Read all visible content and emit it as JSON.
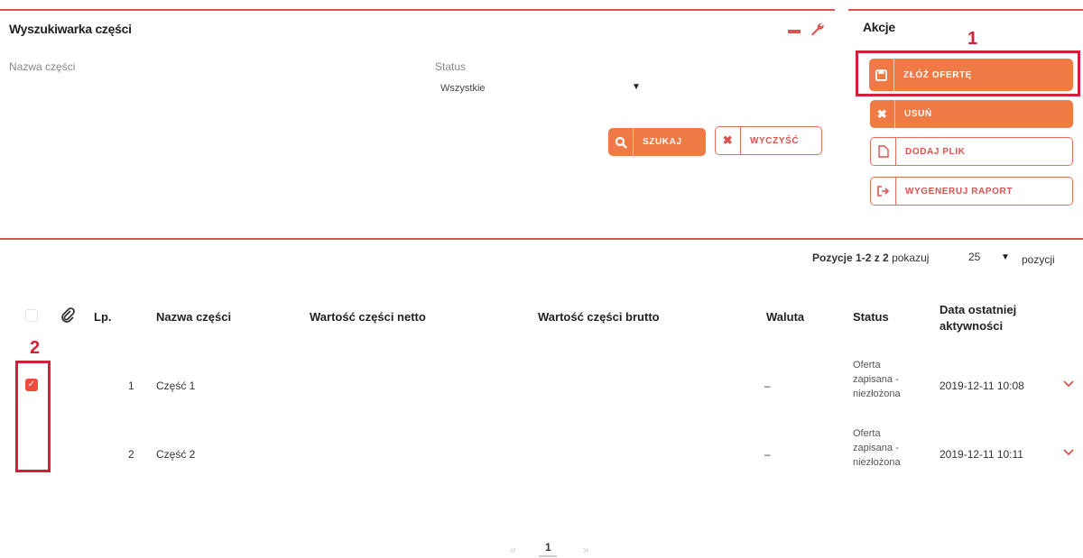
{
  "search_panel": {
    "title": "Wyszukiwarka części",
    "name_label": "Nazwa części",
    "status_label": "Status",
    "status_value": "Wszystkie",
    "search_button": "SZUKAJ",
    "clear_button": "WYCZYŚĆ"
  },
  "actions_panel": {
    "title": "Akcje",
    "buttons": [
      {
        "label": "ZŁÓŻ OFERTĘ",
        "icon": "save-icon"
      },
      {
        "label": "USUŃ",
        "icon": "close-icon"
      },
      {
        "label": "DODAJ PLIK",
        "icon": "file-icon"
      },
      {
        "label": "WYGENERUJ RAPORT",
        "icon": "export-icon"
      }
    ]
  },
  "annotations": {
    "one": "1",
    "two": "2"
  },
  "pagination_info": {
    "range": "Pozycje 1-2 z 2",
    "show": "pokazuj",
    "per_page": "25",
    "items": "pozycji"
  },
  "table": {
    "headers": {
      "lp": "Lp.",
      "name": "Nazwa części",
      "net": "Wartość części netto",
      "gross": "Wartość części brutto",
      "currency": "Waluta",
      "status": "Status",
      "last_activity": "Data ostatniej aktywności"
    },
    "rows": [
      {
        "lp": "1",
        "name": "Część 1",
        "currency": "–",
        "status_l1": "Oferta",
        "status_l2": "zapisana -",
        "status_l3": "niezłożona",
        "date": "2019-12-11 10:08"
      },
      {
        "lp": "2",
        "name": "Część 2",
        "currency": "–",
        "status_l1": "Oferta",
        "status_l2": "zapisana -",
        "status_l3": "niezłożona",
        "date": "2019-12-11 10:11"
      }
    ]
  },
  "pager": {
    "prev": "«",
    "current": "1",
    "next": "»"
  },
  "colors": {
    "accent": "#ef7a45",
    "red": "#d9534f",
    "annotation": "#d1213a"
  }
}
